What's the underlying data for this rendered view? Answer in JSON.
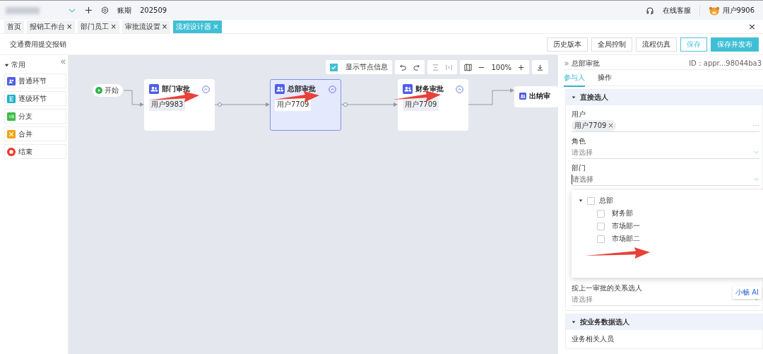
{
  "topbar": {
    "period_label": "账期",
    "period": "202509",
    "service": "在线客服",
    "user": "用户9906"
  },
  "tabs": [
    {
      "label": "首页",
      "selected": false
    },
    {
      "label": "报销工作台",
      "close": "×",
      "selected": false
    },
    {
      "label": "部门员工",
      "close": "×",
      "selected": false
    },
    {
      "label": "审批流设置",
      "close": "×",
      "selected": false
    },
    {
      "label": "流程设计器",
      "close": "×",
      "selected": true
    }
  ],
  "page_close": "×",
  "document": {
    "title": "交通费用提交报销",
    "buttons": [
      {
        "label": "历史版本",
        "kind": "plain"
      },
      {
        "label": "全局控制",
        "kind": "plain"
      },
      {
        "label": "流程仿真",
        "kind": "plain"
      },
      {
        "label": "保存",
        "kind": "outline"
      },
      {
        "label": "保存并发布",
        "kind": "primary"
      }
    ]
  },
  "palette": {
    "group": "常用",
    "expanded": true,
    "items": [
      {
        "label": "普通环节",
        "kind": "normal",
        "color": "#4f5fe8"
      },
      {
        "label": "逐级环节",
        "kind": "level",
        "color": "#1fb2c8"
      },
      {
        "label": "分支",
        "kind": "branch",
        "color": "#3bbb4b"
      },
      {
        "label": "合并",
        "kind": "merge",
        "color": "#f3a516"
      },
      {
        "label": "结束",
        "kind": "end",
        "color": "#e8372b"
      }
    ]
  },
  "canvas": {
    "toolbar": {
      "show_info": {
        "label": "显示节点信息",
        "checked": true
      },
      "zoom": "100%"
    },
    "start": "开始",
    "nodes": [
      {
        "title": "部门审批",
        "user": "用户9983",
        "selected": false
      },
      {
        "title": "总部审批",
        "user": "用户7709",
        "selected": true
      },
      {
        "title": "财务审批",
        "user": "用户7709",
        "selected": false
      },
      {
        "title": "出纳审",
        "selected": false
      }
    ]
  },
  "panel": {
    "title": "总部审批",
    "id": "ID：appr...98044ba3",
    "tabs": [
      {
        "label": "参与人",
        "selected": true
      },
      {
        "label": "操作",
        "selected": false
      }
    ],
    "sections": [
      {
        "title": "直接选人",
        "expanded": true,
        "fields": [
          {
            "label": "用户",
            "kind": "tags",
            "tags": [
              "用户7709"
            ],
            "more": "···"
          },
          {
            "label": "角色",
            "kind": "select",
            "placeholder": "请选择",
            "open": false
          },
          {
            "label": "部门",
            "kind": "select",
            "placeholder": "请选择",
            "open": true,
            "options": [
              {
                "label": "总部",
                "checked": false,
                "expanded": true,
                "children": [
                  {
                    "label": "财务部",
                    "checked": false
                  },
                  {
                    "label": "市场部一",
                    "checked": false
                  },
                  {
                    "label": "市场部二",
                    "checked": false
                  }
                ]
              }
            ]
          },
          {
            "label": "按上一审批的关系选人",
            "kind": "select",
            "placeholder": "请选择",
            "open": false
          }
        ]
      },
      {
        "title": "按业务数据选人",
        "expanded": true,
        "fields": [
          {
            "label": "业务相关人员",
            "kind": "label"
          }
        ]
      }
    ],
    "ai_badge": "小畅 AI"
  }
}
